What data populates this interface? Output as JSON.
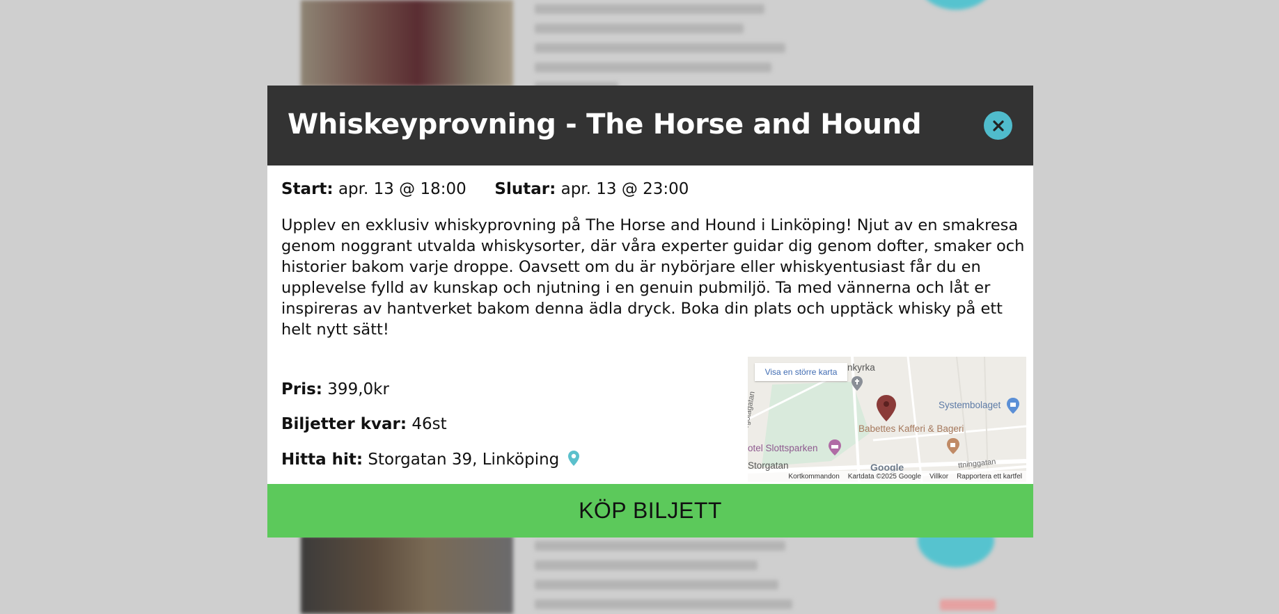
{
  "event": {
    "title": "Whiskeyprovning - The Horse and Hound",
    "start_label": "Start:",
    "start_value": "apr. 13 @ 18:00",
    "end_label": "Slutar:",
    "end_value": "apr. 13 @ 23:00",
    "description": "Upplev en exklusiv whiskyprovning på The Horse and Hound i Linköping! Njut av en smakresa genom noggrant utvalda whiskysorter, där våra experter guidar dig genom dofter, smaker och historier bakom varje droppe. Oavsett om du är nybörjare eller whiskyentusiast får du en upplevelse fylld av kunskap och njutning i en genuin pubmiljö. Ta med vännerna och låt er inspireras av hantverket bakom denna ädla dryck. Boka din plats och upptäck whisky på ett helt nytt sätt!",
    "price_label": "Pris:",
    "price_value": "399,0kr",
    "tickets_label": "Biljetter kvar:",
    "tickets_value": "46st",
    "address_label": "Hitta hit:",
    "address_value": "Storgatan 39, Linköping"
  },
  "map": {
    "larger_map_link": "Visa en större karta",
    "labels": {
      "church": "nkyrka",
      "systembolaget": "Systembolaget",
      "cafe": "Babettes Kafferi & Bageri",
      "hotel": "otel Slottsparken",
      "street_storgatan": "Storgatan",
      "street_left": "rgötagatan",
      "street_right": "ttninggatan"
    },
    "google_logo": "Google",
    "footer": {
      "shortcuts": "Kortkommandon",
      "data": "Kartdata ©2025 Google",
      "terms": "Villkor",
      "report": "Rapportera ett kartfel"
    }
  },
  "buy_button": "KÖP BILJETT",
  "icons": {
    "close": "close-icon",
    "location": "location-pin-icon",
    "map_marker": "map-marker-icon"
  },
  "colors": {
    "header_bg": "#333333",
    "close_bg": "#50bccc",
    "buy_bg": "#5cc95b",
    "pin": "#5bc0cc"
  }
}
